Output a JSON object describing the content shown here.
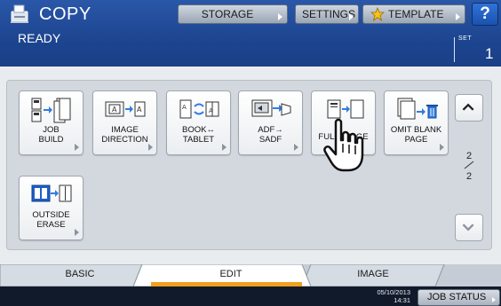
{
  "header": {
    "title": "COPY",
    "storage_label": "STORAGE",
    "settings_label": "SETTINGS",
    "template_label": "TEMPLATE",
    "help_label": "?"
  },
  "status": {
    "text": "READY",
    "set_label": "SET",
    "set_count": "1"
  },
  "functions": [
    {
      "label": "JOB\nBUILD",
      "icon": "job-build-icon"
    },
    {
      "label": "IMAGE\nDIRECTION",
      "icon": "image-direction-icon"
    },
    {
      "label": "BOOK↔\nTABLET",
      "icon": "book-tablet-icon"
    },
    {
      "label": "ADF→\nSADF",
      "icon": "adf-sadf-icon"
    },
    {
      "label": "FULL IMAGE",
      "icon": "full-image-icon"
    },
    {
      "label": "OMIT BLANK\nPAGE",
      "icon": "omit-blank-page-icon"
    },
    {
      "label": "OUTSIDE\nERASE",
      "icon": "outside-erase-icon"
    }
  ],
  "pager": {
    "current": "2",
    "total": "2"
  },
  "tabs": [
    {
      "label": "BASIC",
      "active": false
    },
    {
      "label": "EDIT",
      "active": true
    },
    {
      "label": "IMAGE",
      "active": false
    }
  ],
  "footer": {
    "date": "05/10/2013",
    "time": "14:31",
    "job_status_label": "JOB STATUS"
  },
  "colors": {
    "header_blue": "#1d4590",
    "active_tab_accent": "#f0a020",
    "help_blue": "#2f73d8"
  }
}
